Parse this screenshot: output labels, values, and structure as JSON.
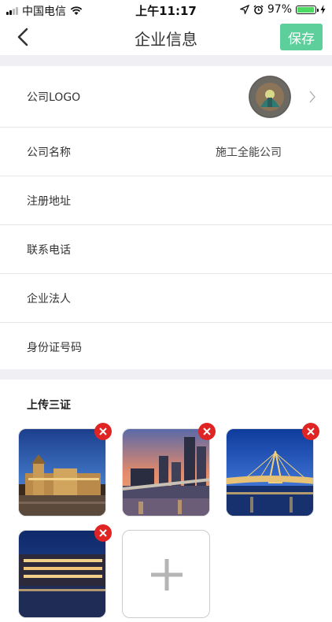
{
  "status_bar": {
    "carrier": "中国电信",
    "time": "上午11:17",
    "battery_percent": "97%",
    "battery_level": 0.97,
    "icons": [
      "signal-icon",
      "wifi-icon",
      "location-icon",
      "alarm-icon",
      "battery-icon",
      "charging-icon"
    ]
  },
  "nav": {
    "title": "企业信息",
    "save_label": "保存",
    "back_icon": "chevron-left-icon"
  },
  "colors": {
    "accent": "#5ccf9b",
    "remove": "#e02424",
    "divider_band": "#f0f0f4"
  },
  "info_rows": {
    "logo": {
      "label": "公司LOGO"
    },
    "company_name": {
      "label": "公司名称",
      "value": "施工全能公司"
    },
    "address": {
      "label": "注册地址",
      "value": ""
    },
    "phone": {
      "label": "联系电话",
      "value": ""
    },
    "legal_person": {
      "label": "企业法人",
      "value": ""
    },
    "id_number": {
      "label": "身份证号码",
      "value": ""
    }
  },
  "upload": {
    "title": "上传三证",
    "photos": [
      {
        "subject": "palace-at-dusk"
      },
      {
        "subject": "city-skyline-sunset"
      },
      {
        "subject": "bridge-at-night"
      },
      {
        "subject": "waterfront-building-night"
      }
    ],
    "add_icon": "plus-icon"
  }
}
